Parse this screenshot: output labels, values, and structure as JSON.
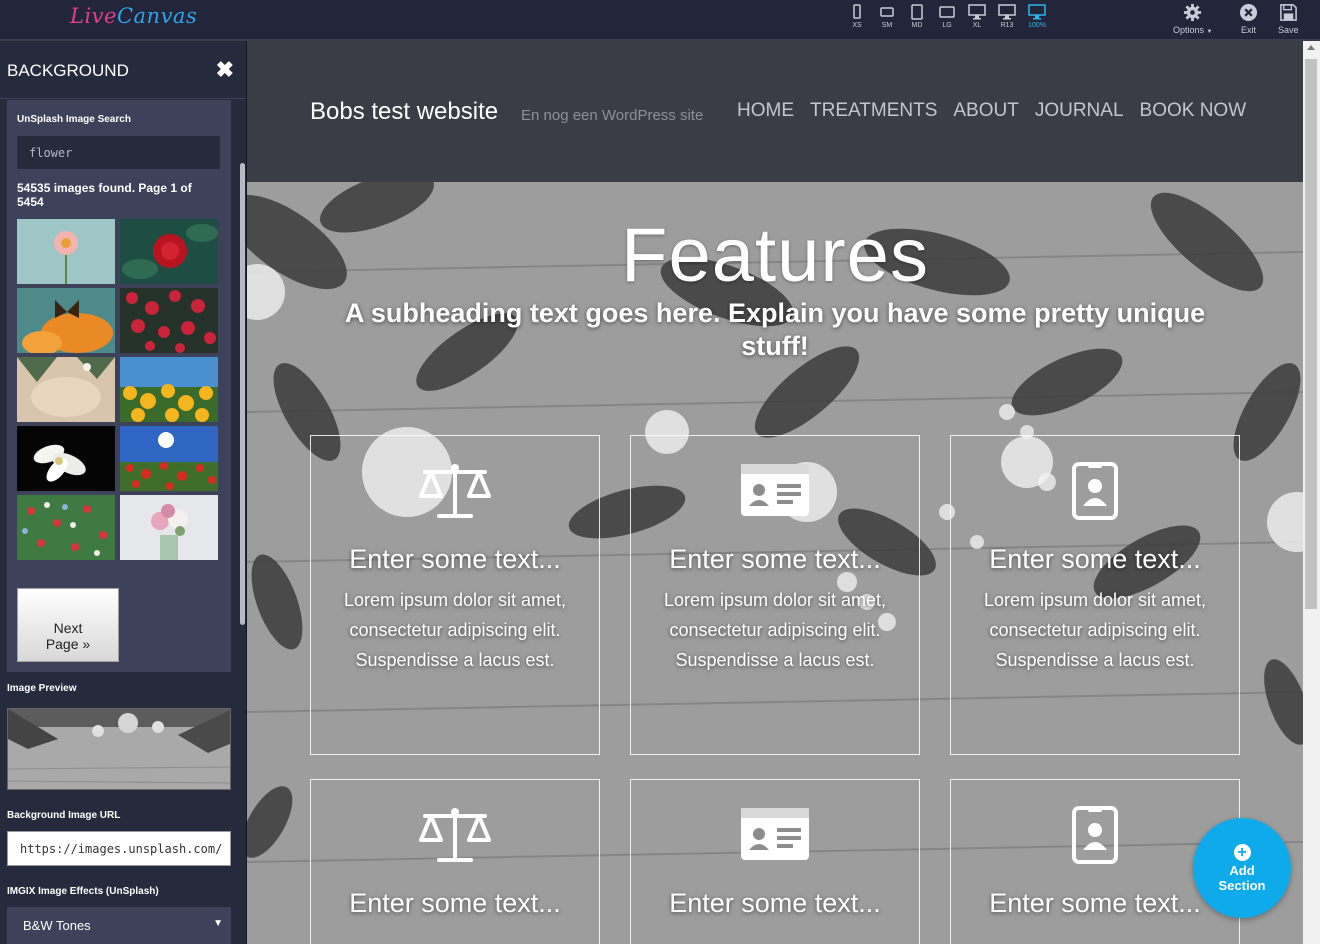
{
  "app": {
    "logo_part1": "Live",
    "logo_part2": "Canvas"
  },
  "toolbar": {
    "devices": [
      {
        "label": "XS",
        "icon": "phone-icon"
      },
      {
        "label": "SM",
        "icon": "phone-landscape-icon"
      },
      {
        "label": "MD",
        "icon": "tablet-icon"
      },
      {
        "label": "LG",
        "icon": "tablet-landscape-icon"
      },
      {
        "label": "XL",
        "icon": "monitor-icon"
      },
      {
        "label": "R13",
        "icon": "monitor-icon"
      },
      {
        "label": "100%",
        "icon": "monitor-icon",
        "active": true
      }
    ],
    "options_label": "Options",
    "exit_label": "Exit",
    "save_label": "Save",
    "accent_color": "#28b7ea"
  },
  "panel": {
    "title": "BACKGROUND",
    "unsplash_label": "UnSplash Image Search",
    "search_value": "flower",
    "found_text": "54535 images found. Page ",
    "page_current": "1",
    "page_of": " of ",
    "page_total": "5454",
    "next_line1": "Next",
    "next_line2": "Page »",
    "preview_label": "Image Preview",
    "url_label": "Background Image URL",
    "url_value": "https://images.unsplash.com/",
    "effects_label": "IMGIX Image Effects (UnSplash)",
    "effects_selected": "B&W Tones"
  },
  "site": {
    "brand": "Bobs test website",
    "tagline": "En nog een WordPress site",
    "nav": [
      "HOME",
      "TREATMENTS",
      "ABOUT",
      "JOURNAL",
      "BOOK NOW"
    ],
    "hero_title": "Features",
    "hero_subtitle": "A subheading text goes here. Explain you have some pretty unique stuff!",
    "cards": [
      {
        "icon": "balance-scale-icon",
        "title": "Enter some text...",
        "body": "Lorem ipsum dolor sit amet, consectetur adipiscing elit. Suspendisse a lacus est."
      },
      {
        "icon": "id-card-icon",
        "title": "Enter some text...",
        "body": "Lorem ipsum dolor sit amet, consectetur adipiscing elit. Suspendisse a lacus est."
      },
      {
        "icon": "id-badge-icon",
        "title": "Enter some text...",
        "body": "Lorem ipsum dolor sit amet, consectetur adipiscing elit. Suspendisse a lacus est."
      },
      {
        "icon": "balance-scale-icon",
        "title": "Enter some text..."
      },
      {
        "icon": "id-card-icon",
        "title": "Enter some text..."
      },
      {
        "icon": "id-badge-icon",
        "title": "Enter some text..."
      }
    ]
  },
  "add_section": {
    "line1": "Add",
    "line2": "Section",
    "color": "#0eaaea"
  }
}
